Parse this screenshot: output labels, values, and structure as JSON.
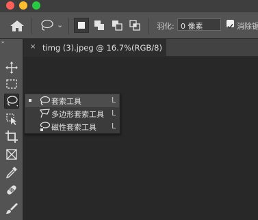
{
  "window": {
    "buttons": [
      {
        "name": "close",
        "color": "#fe5f57"
      },
      {
        "name": "minimize",
        "color": "#febc2e"
      },
      {
        "name": "zoom",
        "color": "#28c840"
      }
    ]
  },
  "options_bar": {
    "home_icon": "home-icon",
    "tool_preset_icon": "lasso-icon",
    "caret": "⌄",
    "selection_modes": [
      {
        "name": "new-selection-icon",
        "active": true
      },
      {
        "name": "add-to-selection-icon",
        "active": false
      },
      {
        "name": "subtract-from-selection-icon",
        "active": false
      },
      {
        "name": "intersect-selection-icon",
        "active": false
      }
    ],
    "feather_label": "羽化:",
    "feather_value": "0 像素",
    "antialias_checked": true,
    "antialias_label": "消除锯"
  },
  "toolbar": {
    "collapse_glyph": "»",
    "tools": [
      {
        "name": "move-tool-icon",
        "active": false
      },
      {
        "name": "marquee-tool-icon",
        "active": false
      },
      {
        "name": "lasso-tool-icon",
        "active": true
      },
      {
        "name": "quick-selection-tool-icon",
        "active": false
      },
      {
        "name": "crop-tool-icon",
        "active": false
      },
      {
        "name": "frame-tool-icon",
        "active": false
      },
      {
        "name": "eyedropper-tool-icon",
        "active": false
      },
      {
        "name": "healing-brush-tool-icon",
        "active": false
      },
      {
        "name": "brush-tool-icon",
        "active": false
      }
    ]
  },
  "document_tab": {
    "close_glyph": "×",
    "title": "timg (3).jpeg @ 16.7%(RGB/8)"
  },
  "lasso_flyout": {
    "items": [
      {
        "label": "套索工具",
        "shortcut": "L",
        "icon": "lasso-icon",
        "selected": true
      },
      {
        "label": "多边形套索工具",
        "shortcut": "L",
        "icon": "polygonal-lasso-icon",
        "selected": false
      },
      {
        "label": "磁性套索工具",
        "shortcut": "L",
        "icon": "magnetic-lasso-icon",
        "selected": false
      }
    ]
  },
  "colors": {
    "panel": "#535353",
    "canvas": "#282828",
    "tab_active": "#2d2d2d"
  }
}
